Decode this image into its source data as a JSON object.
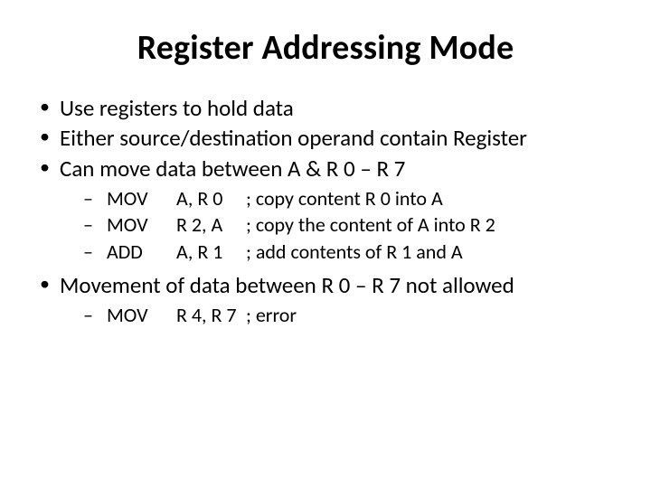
{
  "title": "Register Addressing Mode",
  "bullets": {
    "b1": "Use registers to hold data",
    "b2": "Either source/destination operand contain Register",
    "b3": "Can move data between A & R 0 – R 7",
    "b4": "Movement of data between R 0 – R 7 not allowed"
  },
  "ex1": {
    "r1": {
      "mnem": "MOV",
      "ops": "A, R 0",
      "cmt": "; copy content R 0 into A"
    },
    "r2": {
      "mnem": "MOV",
      "ops": "R 2, A",
      "cmt": "; copy the content of A into R 2"
    },
    "r3": {
      "mnem": "ADD",
      "ops": "A, R 1",
      "cmt": "; add contents of R 1 and A"
    }
  },
  "ex2": {
    "r1": {
      "mnem": "MOV",
      "ops": "R 4, R 7",
      "cmt": "; error"
    }
  }
}
